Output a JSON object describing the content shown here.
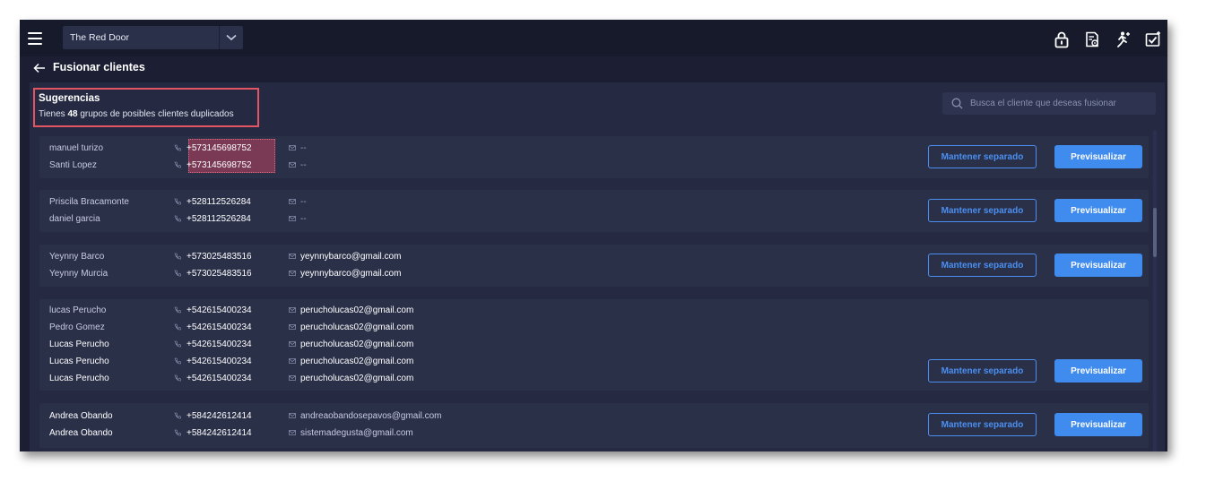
{
  "header": {
    "store": "The Red Door",
    "icons": [
      "menu-icon",
      "chevron-down-icon",
      "lock-icon",
      "document-settings-icon",
      "running-person-icon",
      "checklist-icon"
    ]
  },
  "page": {
    "title": "Fusionar clientes"
  },
  "suggestions": {
    "title": "Sugerencias",
    "sub_prefix": "Tienes",
    "count": "48",
    "sub_suffix": "grupos de posibles clientes duplicados"
  },
  "search": {
    "placeholder": "Busca el cliente que deseas fusionar"
  },
  "buttons": {
    "keep_separate": "Mantener separado",
    "preview": "Previsualizar"
  },
  "groups": [
    {
      "rows": [
        {
          "name": "manuel turizo",
          "phone": "+573145698752",
          "email": "--"
        },
        {
          "name": "Santi Lopez",
          "phone": "+573145698752",
          "email": "--"
        }
      ]
    },
    {
      "rows": [
        {
          "name": "Priscila Bracamonte",
          "phone": "+528112526284",
          "email": "--"
        },
        {
          "name": "daniel garcia",
          "phone": "+528112526284",
          "email": "--"
        }
      ]
    },
    {
      "rows": [
        {
          "name": "Yeynny Barco",
          "phone": "+573025483516",
          "email": "yeynnybarco@gmail.com"
        },
        {
          "name": "Yeynny Murcia",
          "phone": "+573025483516",
          "email": "yeynnybarco@gmail.com"
        }
      ]
    },
    {
      "rows": [
        {
          "name": "lucas Perucho",
          "phone": "+542615400234",
          "email": "perucholucas02@gmail.com"
        },
        {
          "name": "Pedro Gomez",
          "phone": "+542615400234",
          "email": "perucholucas02@gmail.com"
        },
        {
          "name": "Lucas Perucho",
          "phone": "+542615400234",
          "email": "perucholucas02@gmail.com"
        },
        {
          "name": "Lucas Perucho",
          "phone": "+542615400234",
          "email": "perucholucas02@gmail.com"
        },
        {
          "name": "Lucas Perucho",
          "phone": "+542615400234",
          "email": "perucholucas02@gmail.com"
        }
      ]
    },
    {
      "rows": [
        {
          "name": "Andrea Obando",
          "phone": "+584242612414",
          "email": "andreaobandosepavos@gmail.com"
        },
        {
          "name": "Andrea Obando",
          "phone": "+584242612414",
          "email": "sistemadegusta@gmail.com"
        }
      ]
    }
  ]
}
